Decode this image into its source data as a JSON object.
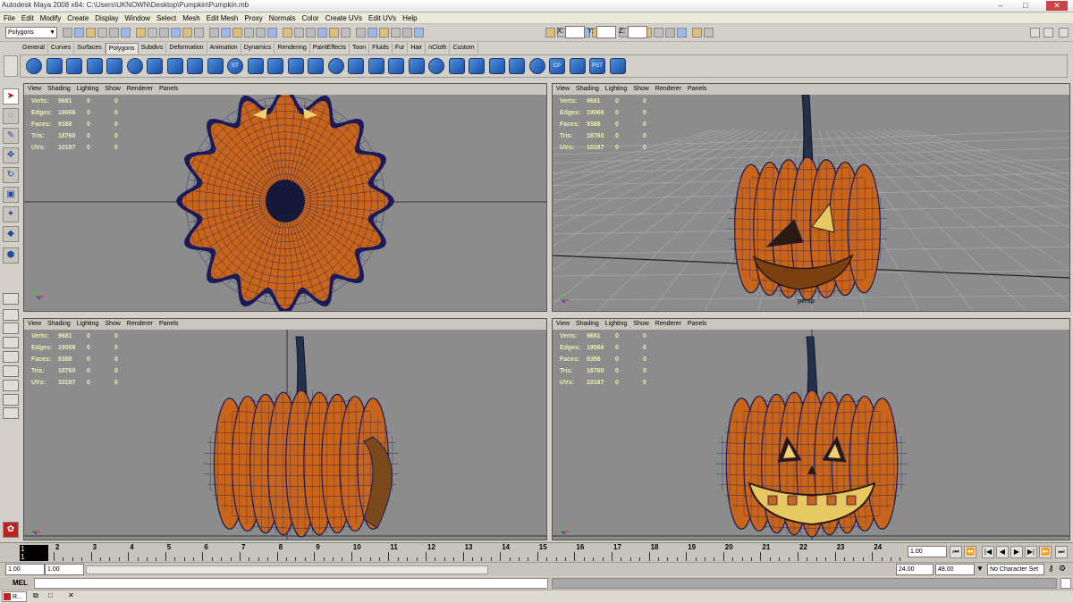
{
  "window": {
    "title": "Autodesk Maya 2008 x64: C:\\Users\\UKNOWN\\Desktop\\Pumpkin\\Pumpkin.mb"
  },
  "menus": [
    "File",
    "Edit",
    "Modify",
    "Create",
    "Display",
    "Window",
    "Select",
    "Mesh",
    "Edit Mesh",
    "Proxy",
    "Normals",
    "Color",
    "Create UVs",
    "Edit UVs",
    "Help"
  ],
  "status_line": {
    "mode": "Polygons",
    "x_label": "X:",
    "y_label": "Y:",
    "z_label": "Z:"
  },
  "shelf_tabs": [
    "General",
    "Curves",
    "Surfaces",
    "Polygons",
    "Subdivs",
    "Deformation",
    "Animation",
    "Dynamics",
    "Rendering",
    "PaintEffects",
    "Toon",
    "Fluids",
    "Fur",
    "Hair",
    "nCloth",
    "Custom"
  ],
  "shelf_active": "Polygons",
  "shelf_icon_labels": {
    "st": "ST",
    "cp": "CP",
    "pst": "PST"
  },
  "panel_menu": [
    "View",
    "Shading",
    "Lighting",
    "Show",
    "Renderer",
    "Panels"
  ],
  "hud": {
    "labels": [
      "Verts:",
      "Edges:",
      "Faces:",
      "Tris:",
      "UVs:"
    ],
    "values": [
      "9681",
      "19066",
      "9388",
      "18760",
      "10187"
    ],
    "zeros": "0"
  },
  "viewports": [
    {
      "name": "top",
      "camera_label": ""
    },
    {
      "name": "persp",
      "camera_label": "persp"
    },
    {
      "name": "side",
      "camera_label": ""
    },
    {
      "name": "front",
      "camera_label": ""
    }
  ],
  "timeline": {
    "current_frame": "1",
    "frames": [
      "2",
      "3",
      "4",
      "5",
      "6",
      "7",
      "8",
      "9",
      "10",
      "11",
      "12",
      "13",
      "14",
      "15",
      "16",
      "17",
      "18",
      "19",
      "20",
      "21",
      "22",
      "23",
      "24"
    ],
    "current_time_field": "1.00"
  },
  "range": {
    "start_time": "1.00",
    "start_range": "1.00",
    "end_range": "24.00",
    "end_time": "48.00",
    "character_set": "No Character Set"
  },
  "command_line": {
    "label": "MEL"
  },
  "taskbar": {
    "item": "R..."
  },
  "colors": {
    "viewport_bg": "#8c8c8c",
    "pumpkin": "#c9651a",
    "wire": "#1b1b5a",
    "hud": "#eeeeb0"
  }
}
